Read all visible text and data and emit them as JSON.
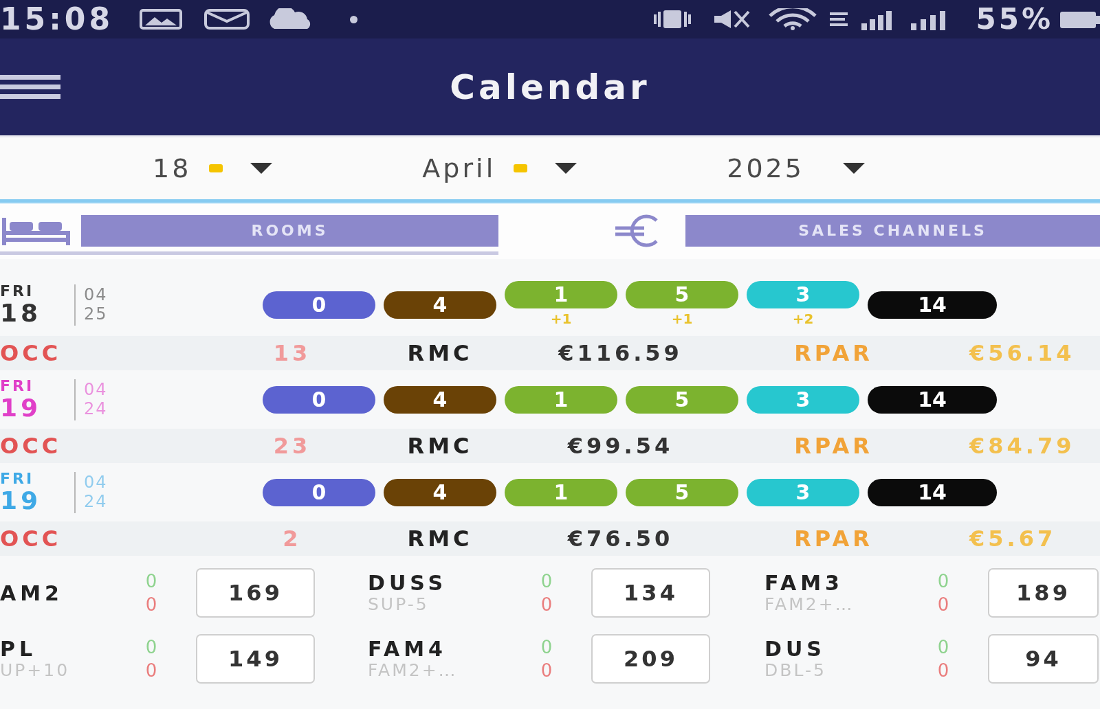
{
  "status_bar": {
    "time": "15:08",
    "battery": "55%"
  },
  "app_bar": {
    "title": "Calendar"
  },
  "date_selectors": [
    {
      "value": "18",
      "dot": true
    },
    {
      "value": "April",
      "dot": true
    },
    {
      "value": "2025",
      "dot": false
    }
  ],
  "tabs": [
    {
      "label": "ROOMS",
      "selected": true
    },
    {
      "label": "SALES CHANNELS",
      "selected": false
    }
  ],
  "days": [
    {
      "weekday": "FRI",
      "day": "18",
      "month": "04",
      "year": "25",
      "color": "#333333",
      "pills": [
        {
          "value": "0",
          "color": "#5c63d0"
        },
        {
          "value": "4",
          "color": "#6a4206"
        },
        {
          "value": "1",
          "color": "#7cb32f",
          "delta": "+1"
        },
        {
          "value": "5",
          "color": "#7cb32f",
          "delta": "+1"
        },
        {
          "value": "3",
          "color": "#27c7cf",
          "delta": "+2"
        },
        {
          "value": "14",
          "color": "#0b0b0b"
        }
      ],
      "stats": [
        {
          "kind": "occ",
          "label": "OCC",
          "value": "13"
        },
        {
          "kind": "rmc",
          "label": "RMC",
          "value": "€116.59"
        },
        {
          "kind": "rpar",
          "label": "RPAR",
          "value": "€56.14"
        }
      ]
    },
    {
      "weekday": "FRI",
      "day": "19",
      "month": "04",
      "year": "24",
      "color": "#e040c8",
      "pills": [
        {
          "value": "0",
          "color": "#5c63d0"
        },
        {
          "value": "4",
          "color": "#6a4206"
        },
        {
          "value": "1",
          "color": "#7cb32f"
        },
        {
          "value": "5",
          "color": "#7cb32f"
        },
        {
          "value": "3",
          "color": "#27c7cf"
        },
        {
          "value": "14",
          "color": "#0b0b0b"
        }
      ],
      "stats": [
        {
          "kind": "occ",
          "label": "OCC",
          "value": "23"
        },
        {
          "kind": "rmc",
          "label": "RMC",
          "value": "€99.54"
        },
        {
          "kind": "rpar",
          "label": "RPAR",
          "value": "€84.79"
        }
      ]
    },
    {
      "weekday": "FRI",
      "day": "19",
      "month": "04",
      "year": "24",
      "color": "#3fa9e6",
      "pills": [
        {
          "value": "0",
          "color": "#5c63d0"
        },
        {
          "value": "4",
          "color": "#6a4206"
        },
        {
          "value": "1",
          "color": "#7cb32f"
        },
        {
          "value": "5",
          "color": "#7cb32f"
        },
        {
          "value": "3",
          "color": "#27c7cf"
        },
        {
          "value": "14",
          "color": "#0b0b0b"
        }
      ],
      "stats": [
        {
          "kind": "occ",
          "label": "OCC",
          "value": "2"
        },
        {
          "kind": "rmc",
          "label": "RMC",
          "value": "€76.50"
        },
        {
          "kind": "rpar",
          "label": "RPAR",
          "value": "€5.67"
        }
      ]
    }
  ],
  "rates": [
    {
      "name": "AM2",
      "upper_count": "0",
      "lower_count": "0",
      "price": "169"
    },
    {
      "name": "DUSS",
      "subtitle": "SUP-5",
      "upper_count": "0",
      "lower_count": "0",
      "price": "134"
    },
    {
      "name": "FAM3",
      "subtitle": "FAM2+…",
      "upper_count": "0",
      "lower_count": "0",
      "price": "189"
    },
    {
      "name": "PL",
      "subtitle": "UP+10",
      "upper_count": "0",
      "lower_count": "0",
      "price": "149"
    },
    {
      "name": "FAM4",
      "subtitle": "FAM2+…",
      "upper_count": "0",
      "lower_count": "0",
      "price": "209"
    },
    {
      "name": "DUS",
      "subtitle": "DBL-5",
      "upper_count": "0",
      "lower_count": "0",
      "price": "94"
    }
  ]
}
